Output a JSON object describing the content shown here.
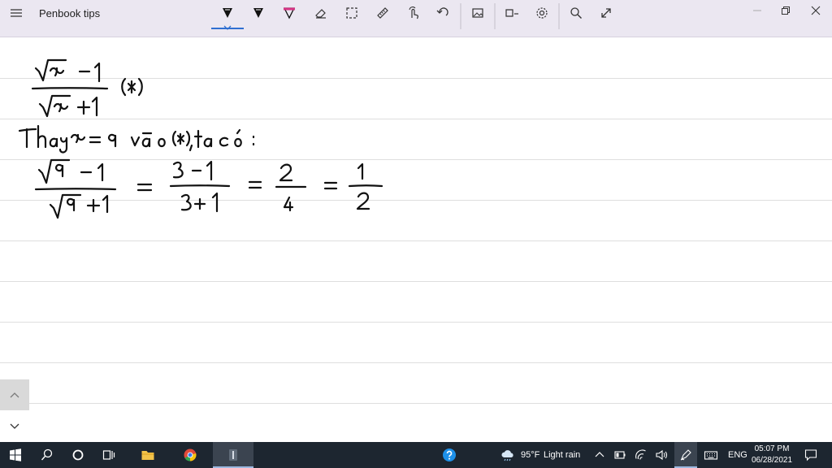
{
  "app": {
    "title": "Penbook tips"
  },
  "toolbar": {
    "tools": [
      "pen-tool",
      "pen-tool",
      "highlighter-tool",
      "eraser-tool",
      "lasso-select-tool",
      "ruler-tool",
      "touch-writing-tool",
      "undo-tool",
      "insert-image-tool",
      "shapes-tool",
      "settings-tool",
      "search-tool",
      "fullscreen-tool"
    ],
    "accent_color": "#2f6fd1",
    "highlighter_color": "#d63384"
  },
  "window_controls": [
    "minimize",
    "maximize",
    "close"
  ],
  "note": {
    "handwriting_lines": [
      "√x − 1 / √x + 1 (*)",
      "Thay x = 9 vào (*), ta có:",
      "√9 − 1 / √9 + 1 = 3 − 1 / 3 + 1 = 2 / 4 = 1 / 2"
    ]
  },
  "taskbar": {
    "weather_temp": "95°F",
    "weather_text": "Light rain",
    "language": "ENG",
    "time": "05:07 PM",
    "date": "06/28/2021"
  }
}
